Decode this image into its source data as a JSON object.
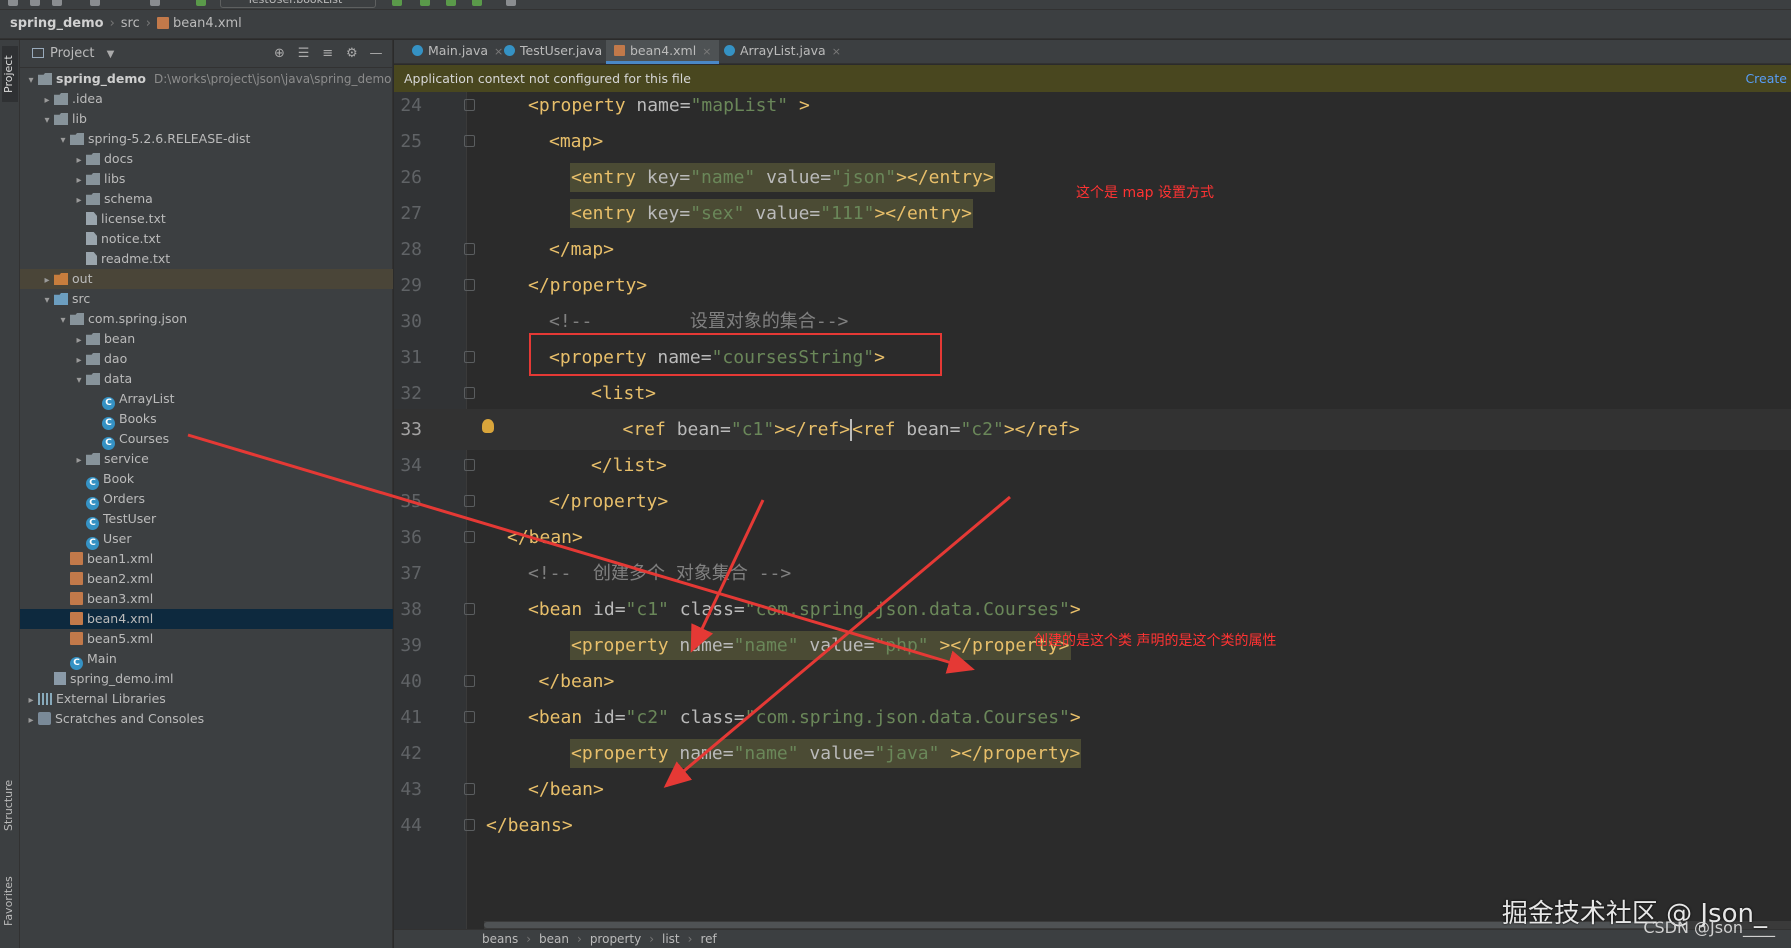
{
  "toolbar": {
    "run_config": "TestUser.bookList"
  },
  "breadcrumb_top": [
    "spring_demo",
    "src",
    "bean4.xml"
  ],
  "left_strip": {
    "project": "Project",
    "structure": "Structure",
    "favorites": "Favorites"
  },
  "project_panel": {
    "title": "Project",
    "tree": [
      {
        "label": "spring_demo",
        "path": "D:\\works\\project\\json\\java\\spring_demo",
        "indent": 0,
        "arrow": "▾",
        "icon": "folder-icon"
      },
      {
        "label": ".idea",
        "indent": 1,
        "arrow": "▸",
        "icon": "folder-icon"
      },
      {
        "label": "lib",
        "indent": 1,
        "arrow": "▾",
        "icon": "folder-icon"
      },
      {
        "label": "spring-5.2.6.RELEASE-dist",
        "indent": 2,
        "arrow": "▾",
        "icon": "folder-icon"
      },
      {
        "label": "docs",
        "indent": 3,
        "arrow": "▸",
        "icon": "folder-icon"
      },
      {
        "label": "libs",
        "indent": 3,
        "arrow": "▸",
        "icon": "folder-icon"
      },
      {
        "label": "schema",
        "indent": 3,
        "arrow": "▸",
        "icon": "folder-icon"
      },
      {
        "label": "license.txt",
        "indent": 3,
        "arrow": "",
        "icon": "text-file-icon"
      },
      {
        "label": "notice.txt",
        "indent": 3,
        "arrow": "",
        "icon": "text-file-icon"
      },
      {
        "label": "readme.txt",
        "indent": 3,
        "arrow": "",
        "icon": "text-file-icon"
      },
      {
        "label": "out",
        "indent": 1,
        "arrow": "▸",
        "icon": "output-folder-icon"
      },
      {
        "label": "src",
        "indent": 1,
        "arrow": "▾",
        "icon": "source-folder-icon"
      },
      {
        "label": "com.spring.json",
        "indent": 2,
        "arrow": "▾",
        "icon": "package-icon"
      },
      {
        "label": "bean",
        "indent": 3,
        "arrow": "▸",
        "icon": "package-icon"
      },
      {
        "label": "dao",
        "indent": 3,
        "arrow": "▸",
        "icon": "package-icon"
      },
      {
        "label": "data",
        "indent": 3,
        "arrow": "▾",
        "icon": "package-icon"
      },
      {
        "label": "ArrayList",
        "indent": 4,
        "arrow": "",
        "icon": "class-icon"
      },
      {
        "label": "Books",
        "indent": 4,
        "arrow": "",
        "icon": "class-icon"
      },
      {
        "label": "Courses",
        "indent": 4,
        "arrow": "",
        "icon": "class-icon"
      },
      {
        "label": "service",
        "indent": 3,
        "arrow": "▸",
        "icon": "package-icon"
      },
      {
        "label": "Book",
        "indent": 3,
        "arrow": "",
        "icon": "class-icon"
      },
      {
        "label": "Orders",
        "indent": 3,
        "arrow": "",
        "icon": "class-icon"
      },
      {
        "label": "TestUser",
        "indent": 3,
        "arrow": "",
        "icon": "class-icon"
      },
      {
        "label": "User",
        "indent": 3,
        "arrow": "",
        "icon": "class-icon"
      },
      {
        "label": "bean1.xml",
        "indent": 2,
        "arrow": "",
        "icon": "xml-file-icon"
      },
      {
        "label": "bean2.xml",
        "indent": 2,
        "arrow": "",
        "icon": "xml-file-icon"
      },
      {
        "label": "bean3.xml",
        "indent": 2,
        "arrow": "",
        "icon": "xml-file-icon"
      },
      {
        "label": "bean4.xml",
        "indent": 2,
        "arrow": "",
        "icon": "xml-file-icon",
        "selected": true
      },
      {
        "label": "bean5.xml",
        "indent": 2,
        "arrow": "",
        "icon": "xml-file-icon"
      },
      {
        "label": "Main",
        "indent": 2,
        "arrow": "",
        "icon": "class-icon"
      },
      {
        "label": "spring_demo.iml",
        "indent": 1,
        "arrow": "",
        "icon": "module-file-icon"
      },
      {
        "label": "External Libraries",
        "indent": 0,
        "arrow": "▸",
        "icon": "libraries-icon"
      },
      {
        "label": "Scratches and Consoles",
        "indent": 0,
        "arrow": "▸",
        "icon": "scratches-icon"
      }
    ]
  },
  "editor_tabs": [
    {
      "label": "Main.java",
      "icon": "java-class-icon",
      "active": false
    },
    {
      "label": "TestUser.java",
      "icon": "java-class-icon",
      "active": false
    },
    {
      "label": "bean4.xml",
      "icon": "xml-file-icon",
      "active": true
    },
    {
      "label": "ArrayList.java",
      "icon": "java-class-icon",
      "active": false
    }
  ],
  "banner": {
    "message": "Application context not configured for this file",
    "action": "Create"
  },
  "code_lines": [
    {
      "n": "24",
      "fold": true,
      "indent": 2,
      "hl": false,
      "tokens": [
        [
          "t",
          "<property "
        ],
        [
          "a",
          "name="
        ],
        [
          "v",
          "\"mapList\""
        ],
        [
          "t",
          " >"
        ]
      ]
    },
    {
      "n": "25",
      "fold": true,
      "indent": 3,
      "hl": false,
      "tokens": [
        [
          "t",
          "<map>"
        ]
      ]
    },
    {
      "n": "26",
      "fold": false,
      "indent": 4,
      "hl": true,
      "tokens": [
        [
          "t",
          "<entry "
        ],
        [
          "a",
          "key="
        ],
        [
          "v",
          "\"name\""
        ],
        [
          "a",
          " value="
        ],
        [
          "v",
          "\"json\""
        ],
        [
          "t",
          "></entry>"
        ]
      ]
    },
    {
      "n": "27",
      "fold": false,
      "indent": 4,
      "hl": true,
      "tokens": [
        [
          "t",
          "<entry "
        ],
        [
          "a",
          "key="
        ],
        [
          "v",
          "\"sex\""
        ],
        [
          "a",
          " value="
        ],
        [
          "v",
          "\"111\""
        ],
        [
          "t",
          "></entry>"
        ]
      ]
    },
    {
      "n": "28",
      "fold": true,
      "indent": 3,
      "hl": false,
      "tokens": [
        [
          "t",
          "</map>"
        ]
      ]
    },
    {
      "n": "29",
      "fold": true,
      "indent": 2,
      "hl": false,
      "tokens": [
        [
          "t",
          "</property>"
        ]
      ]
    },
    {
      "n": "30",
      "fold": false,
      "indent": 3,
      "hl": false,
      "tokens": [
        [
          "c",
          "<!--         设置对象的集合-->"
        ]
      ]
    },
    {
      "n": "31",
      "fold": true,
      "indent": 3,
      "hl": false,
      "tokens": [
        [
          "t",
          "<property "
        ],
        [
          "a",
          "name="
        ],
        [
          "v",
          "\"coursesString\""
        ],
        [
          "t",
          ">"
        ]
      ]
    },
    {
      "n": "32",
      "fold": true,
      "indent": 5,
      "hl": false,
      "tokens": [
        [
          "t",
          "<list>"
        ]
      ]
    },
    {
      "n": "33",
      "fold": false,
      "indent": 6.5,
      "hl": false,
      "current": true,
      "tokens": [
        [
          "t",
          "<ref "
        ],
        [
          "a",
          "bean="
        ],
        [
          "v",
          "\"c1\""
        ],
        [
          "t",
          "></ref>"
        ],
        [
          "caret",
          ""
        ],
        [
          "t",
          "<ref "
        ],
        [
          "a",
          "bean="
        ],
        [
          "v",
          "\"c2\""
        ],
        [
          "t",
          "></ref>"
        ]
      ]
    },
    {
      "n": "34",
      "fold": true,
      "indent": 5,
      "hl": false,
      "tokens": [
        [
          "t",
          "</list>"
        ]
      ]
    },
    {
      "n": "35",
      "fold": true,
      "indent": 3,
      "hl": false,
      "tokens": [
        [
          "t",
          "</property>"
        ]
      ]
    },
    {
      "n": "36",
      "fold": true,
      "indent": 1,
      "hl": false,
      "tokens": [
        [
          "t",
          "</bean>"
        ]
      ]
    },
    {
      "n": "37",
      "fold": false,
      "indent": 2,
      "hl": false,
      "tokens": [
        [
          "c",
          "<!--  创建多个 对象集合 -->"
        ]
      ]
    },
    {
      "n": "38",
      "fold": true,
      "indent": 2,
      "hl": false,
      "tokens": [
        [
          "t",
          "<bean "
        ],
        [
          "a",
          "id="
        ],
        [
          "v",
          "\"c1\""
        ],
        [
          "a",
          " class="
        ],
        [
          "v",
          "\"com.spring.json.data.Courses\""
        ],
        [
          "t",
          ">"
        ]
      ]
    },
    {
      "n": "39",
      "fold": false,
      "indent": 4,
      "hl": true,
      "tokens": [
        [
          "t",
          "<property "
        ],
        [
          "a",
          "name="
        ],
        [
          "v",
          "\"name\""
        ],
        [
          "a",
          " value="
        ],
        [
          "v",
          "\"php\""
        ],
        [
          "t",
          " ></property>"
        ]
      ]
    },
    {
      "n": "40",
      "fold": true,
      "indent": 2.5,
      "hl": false,
      "tokens": [
        [
          "t",
          "</bean>"
        ]
      ]
    },
    {
      "n": "41",
      "fold": true,
      "indent": 2,
      "hl": false,
      "tokens": [
        [
          "t",
          "<bean "
        ],
        [
          "a",
          "id="
        ],
        [
          "v",
          "\"c2\""
        ],
        [
          "a",
          " class="
        ],
        [
          "v",
          "\"com.spring.json.data.Courses\""
        ],
        [
          "t",
          ">"
        ]
      ]
    },
    {
      "n": "42",
      "fold": false,
      "indent": 4,
      "hl": true,
      "tokens": [
        [
          "t",
          "<property "
        ],
        [
          "a",
          "name="
        ],
        [
          "v",
          "\"name\""
        ],
        [
          "a",
          " value="
        ],
        [
          "v",
          "\"java\""
        ],
        [
          "t",
          " ></property>"
        ]
      ]
    },
    {
      "n": "43",
      "fold": true,
      "indent": 2,
      "hl": false,
      "tokens": [
        [
          "t",
          "</bean>"
        ]
      ]
    },
    {
      "n": "44",
      "fold": true,
      "indent": 0,
      "hl": false,
      "tokens": [
        [
          "t",
          "</beans>"
        ]
      ]
    }
  ],
  "annotations": {
    "map_note": "这个是 map 设置方式",
    "class_note": "创建的是这个类 声明的是这个类的属性"
  },
  "bottom_breadcrumb": [
    "beans",
    "bean",
    "property",
    "list",
    "ref"
  ],
  "watermark": {
    "main": "掘金技术社区 @ Json_",
    "sub": "CSDN @Json____"
  }
}
